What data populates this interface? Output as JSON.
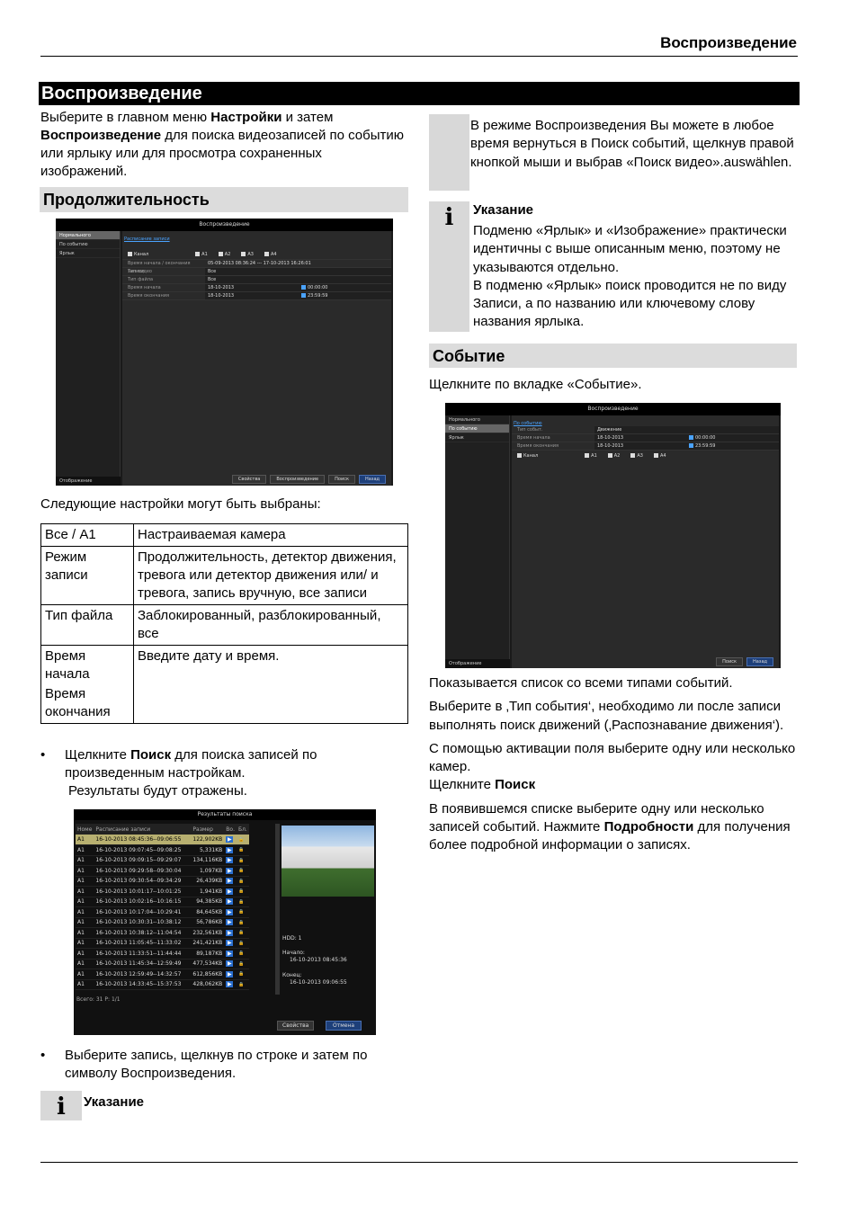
{
  "header": {
    "title": "Воспроизведение"
  },
  "main_title": "Воспроизведение",
  "intro": {
    "t1": "Выберите в главном меню ",
    "b1": "Настройки",
    "t2": " и затем ",
    "b2": "Воспроизведение",
    "t3": " для поиска видеозаписей по событию или ярлыку или для просмотра сохраненных изображений."
  },
  "duration": {
    "title": "Продолжительность"
  },
  "dvr1": {
    "title": "Воспроизведение",
    "side_items": [
      "Нормального",
      "По событию",
      "Ярлык"
    ],
    "side_bottom": "Отображение",
    "link": "Расписание записи",
    "cams": [
      "Канал",
      "A1",
      "A2",
      "A3",
      "A4"
    ],
    "rows": [
      {
        "k": "Время начала / окончания записи",
        "v": "05-09-2013 08:36:24   ---   17-10-2013 16:26:01"
      },
      {
        "k": "Тип видео",
        "v": "Все"
      },
      {
        "k": "Тип файла",
        "v": "Все"
      },
      {
        "k": "Время начала",
        "v": "18-10-2013",
        "t": "00:00:00"
      },
      {
        "k": "Время окончания",
        "v": "18-10-2013",
        "t": "23:59:59"
      }
    ],
    "buttons": [
      "Свойства",
      "Воспроизведение",
      "Поиск",
      "Назад"
    ]
  },
  "settings_text": "Следующие настройки могут быть выбраны:",
  "table": [
    {
      "a": "Все / A1",
      "b": "Настраиваемая камера"
    },
    {
      "a": "Режим записи",
      "b": "Продолжительность, детектор движения, тревога или детектор движения или/ и тревога, запись вручную, все записи"
    },
    {
      "a": "Тип файла",
      "b": "Заблокированный, разблокированный, все"
    },
    {
      "a": "Время начала",
      "a2": "Время окончания",
      "b": "Введите дату и время."
    }
  ],
  "bullet1": {
    "t1": "Щелкните ",
    "b": "Поиск",
    "t2": " для поиска записей по произведенным настройкам.",
    "t3": "Результаты будут отражены."
  },
  "results": {
    "title": "Результаты поиска",
    "cols": [
      "Номе",
      "Расписание записи",
      "Размер",
      "Во.",
      "Бл."
    ],
    "rows": [
      [
        "A1",
        "16-10-2013 08:45:36--09:06:55",
        "122,902KB"
      ],
      [
        "A1",
        "16-10-2013 09:07:45--09:08:25",
        "5,331KB"
      ],
      [
        "A1",
        "16-10-2013 09:09:15--09:29:07",
        "134,116KB"
      ],
      [
        "A1",
        "16-10-2013 09:29:58--09:30:04",
        "1,097KB"
      ],
      [
        "A1",
        "16-10-2013 09:30:54--09:34:29",
        "26,439KB"
      ],
      [
        "A1",
        "16-10-2013 10:01:17--10:01:25",
        "1,941KB"
      ],
      [
        "A1",
        "16-10-2013 10:02:16--10:16:15",
        "94,385KB"
      ],
      [
        "A1",
        "16-10-2013 10:17:04--10:29:41",
        "84,645KB"
      ],
      [
        "A1",
        "16-10-2013 10:30:31--10:38:12",
        "56,786KB"
      ],
      [
        "A1",
        "16-10-2013 10:38:12--11:04:54",
        "232,561KB"
      ],
      [
        "A1",
        "16-10-2013 11:05:45--11:33:02",
        "241,421KB"
      ],
      [
        "A1",
        "16-10-2013 11:33:51--11:44:44",
        "89,187KB"
      ],
      [
        "A1",
        "16-10-2013 11:45:34--12:59:49",
        "477,534KB"
      ],
      [
        "A1",
        "16-10-2013 12:59:49--14:32:57",
        "612,856KB"
      ],
      [
        "A1",
        "16-10-2013 14:33:45--15:37:53",
        "428,062KB"
      ]
    ],
    "total": "Всего: 31  P: 1/1",
    "hdd": "HDD: 1",
    "start_label": "Начало:",
    "start": "16-10-2013 08:45:36",
    "end_label": "Конец:",
    "end": "16-10-2013 09:06:55",
    "btn1": "Свойства",
    "btn2": "Отмена"
  },
  "bullet2": "Выберите запись, щелкнув по строке и затем по символу Воспроизведения.",
  "note_bottom": "Указание",
  "right_note1": "В режиме Воспроизведения Вы можете в любое время вернуться в Поиск событий, щелкнув правой кнопкой мыши и выбрав «Поиск видео».auswählen.",
  "right_note2": {
    "title": "Указание",
    "p1": "Подменю «Ярлык» и «Изображение» практически идентичны с выше описанным меню, поэтому не указываются отдельно.",
    "p2": "В подменю «Ярлык» поиск проводится не по виду Записи, а по названию или ключевому слову названия ярлыка."
  },
  "event": {
    "title": "Событие",
    "click": "Щелкните по вкладке «Событие»."
  },
  "dvr2": {
    "title": "Воспроизведение",
    "side_items": [
      "Нормального",
      "По событию",
      "Ярлык"
    ],
    "side_bottom": "Отображение",
    "link": "По событию",
    "rows": [
      {
        "k": "Тип событ.",
        "v": "Движение"
      },
      {
        "k": "Время начала",
        "v": "18-10-2013",
        "t": "00:00:00"
      },
      {
        "k": "Время окончания",
        "v": "18-10-2013",
        "t": "23:59:59"
      }
    ],
    "cams": [
      "Канал",
      "A1",
      "A2",
      "A3",
      "A4"
    ],
    "buttons": [
      "Поиск",
      "Назад"
    ]
  },
  "right_text": {
    "p1": "Показывается список со всеми типами событий.",
    "p2": "Выберите в ‚Тип события‘, необходимо ли после записи выполнять поиск движений (‚Распознавание движения‘).",
    "p3": "С помощью активации поля выберите одну или несколько камер.",
    "p4a": "Щелкните ",
    "p4b": "Поиск",
    "p5a": "В появившемся списке выберите одну или несколько записей событий. Нажмите ",
    "p5b": "Подробности",
    "p5c": " для получения более подробной информации о записях."
  },
  "colors": {
    "rule": "#000000",
    "section_bg": "#dcdcdc",
    "link": "#4aa3ff"
  },
  "icons": [
    "info-icon",
    "checkbox-icon",
    "calendar-icon",
    "play-icon",
    "lock-icon"
  ]
}
